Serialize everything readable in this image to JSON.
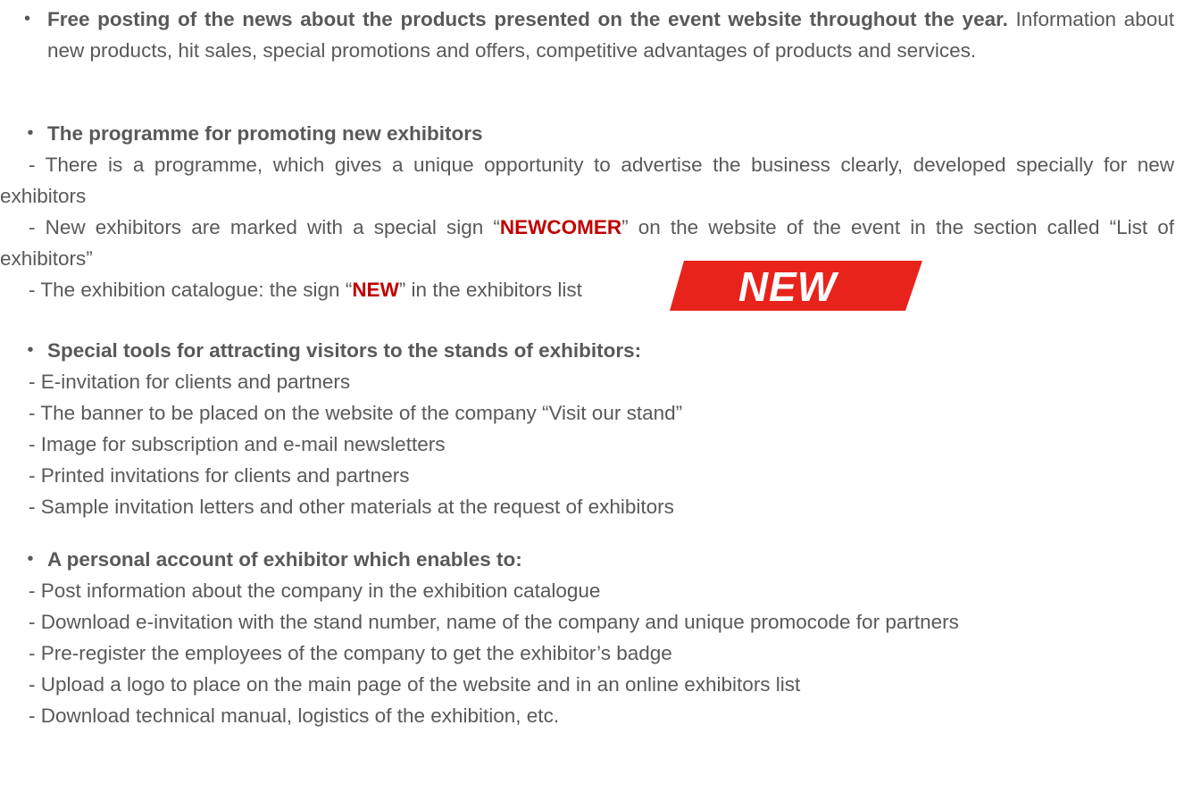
{
  "section1": {
    "bold": "Free posting of the news about the products presented on the event website throughout the year.",
    "text": " Information about new products, hit sales, special promotions and offers, competitive advantages of products and services."
  },
  "section2": {
    "title": "The programme for promoting new exhibitors",
    "item1": "- There is a programme, which gives a unique opportunity to advertise the business clearly, developed specially for new exhibitors",
    "item2_before": "- New exhibitors are marked with a special sign “",
    "item2_highlight": "NEWCOMER",
    "item2_after": "” on the website of the event in the section called “List of exhibitors”",
    "item3_before": "- The exhibition catalogue: the sign “",
    "item3_highlight": "NEW",
    "item3_after": "” in the exhibitors list",
    "badge_text": "NEW",
    "badge_color": "#e8231b"
  },
  "section3": {
    "title": "Special tools for attracting visitors to the stands of exhibitors:",
    "items": [
      "- E-invitation for clients and partners",
      "- The banner to be placed on the website of the company “Visit our stand”",
      "- Image for subscription and e-mail newsletters",
      "- Printed invitations for clients and partners",
      "- Sample  invitation letters and other materials at the request of exhibitors"
    ]
  },
  "section4": {
    "title": "A personal account of exhibitor which enables to:",
    "item1": "- Post information about the company in the exhibition catalogue",
    "item2": "- Download e-invitation with the stand number, name of the company and unique promocode for partners",
    "item3": "- Pre-register the employees of the company to get the exhibitor’s badge",
    "item4": "- Upload a logo to place on the main page of the website and in an online exhibitors list",
    "item5": "- Download technical manual, logistics of the exhibition, etc."
  },
  "colors": {
    "text": "#595959",
    "highlight": "#c00000"
  }
}
